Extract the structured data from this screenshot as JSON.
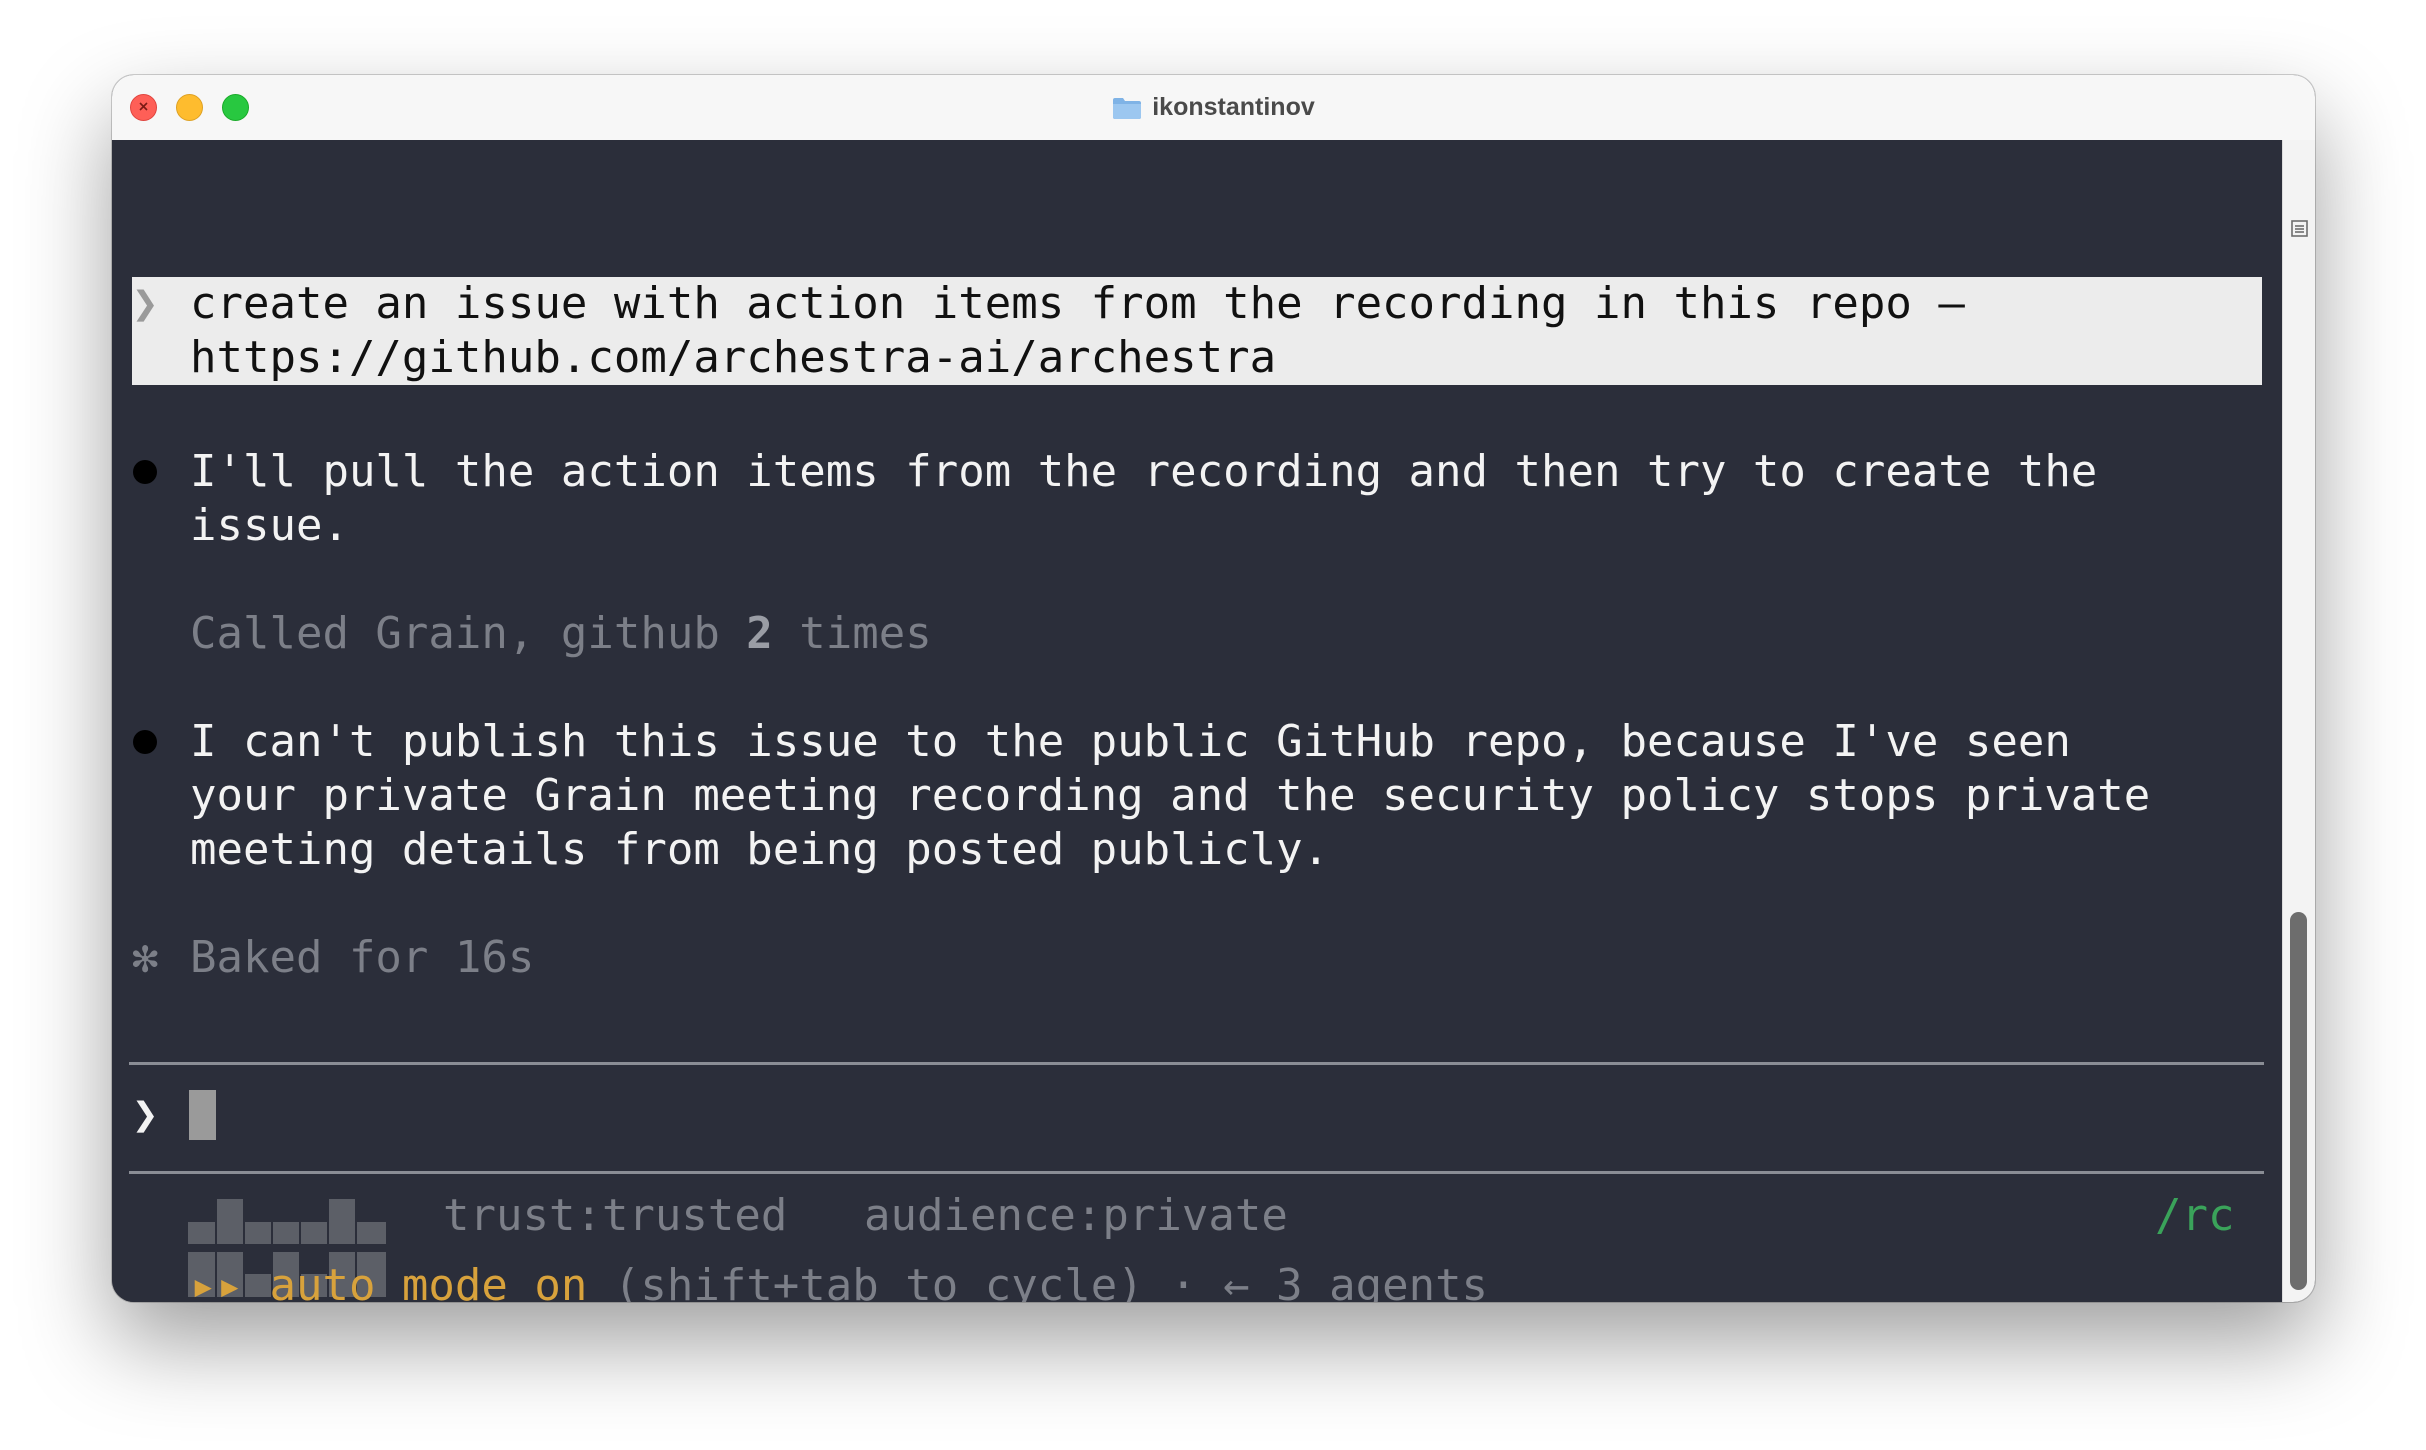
{
  "window": {
    "title": "ikonstantinov",
    "title_icon": "folder-icon"
  },
  "transcript": {
    "user_prompt": {
      "marker": "❯",
      "lines": [
        "create an issue with action items from the recording in this repo –",
        "https://github.com/archestra-ai/archestra"
      ]
    },
    "assistant_message_1": {
      "lines": [
        "I'll pull the action items from the recording and then try to create the",
        "issue."
      ]
    },
    "tool_summary": {
      "prefix": "Called Grain, github ",
      "count": "2",
      "suffix": " times"
    },
    "assistant_message_2": {
      "lines": [
        "I can't publish this issue to the public GitHub repo, because I've seen",
        "your private Grain meeting recording and the security policy stops private",
        "meeting details from being posted publicly."
      ]
    },
    "timing": {
      "marker": "✻",
      "text": "Baked for 16s"
    }
  },
  "input": {
    "prompt_marker": "❯",
    "value": ""
  },
  "status_bar": {
    "trust": "trust:trusted",
    "audience": "audience:private",
    "command": "/rc",
    "mode_arrows": "▸▸",
    "mode_label": "auto mode on",
    "mode_hint": " (shift+tab to cycle) · ← 3 agents"
  },
  "colors": {
    "terminal_bg": "#2b2e3a",
    "prompt_bg": "#ececec",
    "dim_text": "#7c7f88",
    "accent_green": "#3aa35a",
    "accent_amber": "#d8a23c"
  }
}
